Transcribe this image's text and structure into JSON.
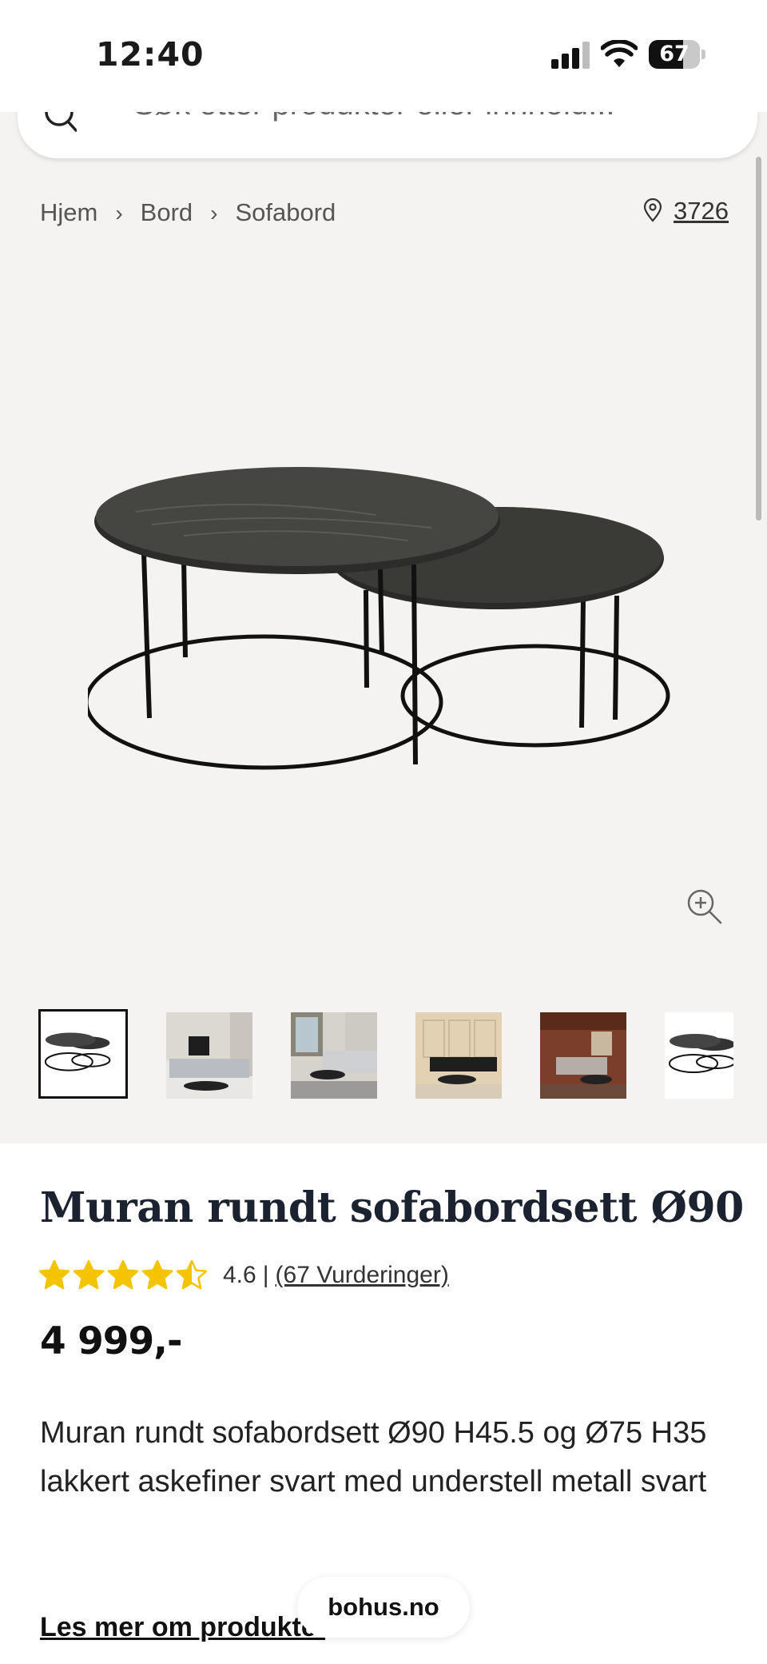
{
  "status_bar": {
    "time": "12:40",
    "battery": 67
  },
  "search": {
    "placeholder": "Søk etter produkter eller innhold..."
  },
  "breadcrumb": {
    "items": [
      "Hjem",
      "Bord",
      "Sofabord"
    ]
  },
  "store": {
    "code": "3726"
  },
  "gallery": {
    "thumbnails": [
      "product-table-thumbnail",
      "living-room-sofa-thumbnail",
      "living-room-grey-sofa-thumbnail",
      "beige-room-sofa-thumbnail",
      "wooden-cabin-room-thumbnail",
      "product-table-thumbnail"
    ]
  },
  "product": {
    "title": "Muran rundt sofabordsett Ø90",
    "rating": {
      "score": "4.6",
      "stars": 4.5,
      "separator": "|",
      "count_label": "(67 Vurderinger)"
    },
    "price": "4 999,-",
    "description": "Muran rundt sofabordsett Ø90 H45.5 og Ø75 H35 lakkert askefiner svart med understell metall svart",
    "read_more": "Les mer om produktet"
  },
  "url_pill": "bohus.no",
  "colors": {
    "star": "#f5c400",
    "title": "#1b2330",
    "gray_bg": "#f4f3f1"
  }
}
